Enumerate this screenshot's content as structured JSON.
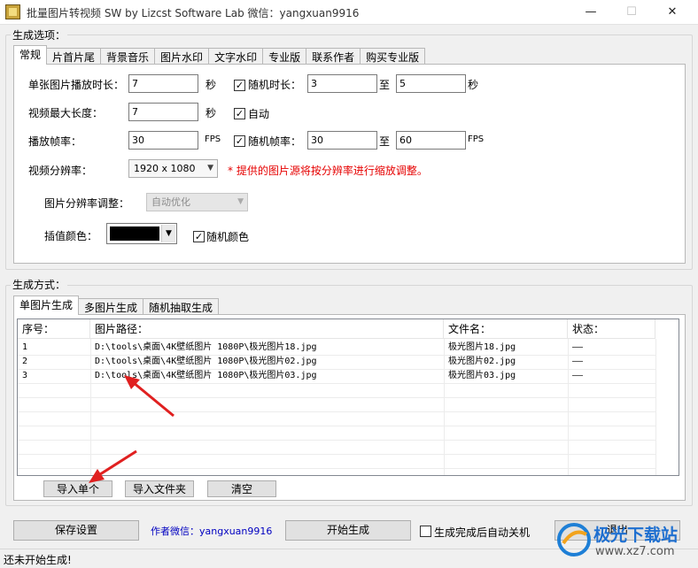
{
  "window": {
    "title": "批量图片转视频 SW  by Lizcst Software Lab  微信：yangxuan9916",
    "min_icon": "—",
    "max_icon": "☐",
    "close_icon": "✕"
  },
  "options_group": {
    "label": "生成选项：",
    "tabs": [
      "常规",
      "片首片尾",
      "背景音乐",
      "图片水印",
      "文字水印",
      "专业版",
      "联系作者",
      "购买专业版"
    ],
    "active_tab": "常规"
  },
  "general": {
    "single_duration_label": "单张图片播放时长：",
    "single_duration_value": "7",
    "single_duration_unit": "秒",
    "random_duration_label": "随机时长：",
    "random_duration_checked": true,
    "random_duration_from": "3",
    "random_duration_to_label": "至",
    "random_duration_to": "5",
    "random_duration_unit": "秒",
    "max_length_label": "视频最大长度：",
    "max_length_value": "7",
    "max_length_unit": "秒",
    "auto_label": "自动",
    "auto_checked": true,
    "fps_label": "播放帧率：",
    "fps_value": "30",
    "fps_unit": "FPS",
    "random_fps_label": "随机帧率：",
    "random_fps_checked": true,
    "random_fps_from": "30",
    "random_fps_to_label": "至",
    "random_fps_to": "60",
    "random_fps_unit": "FPS",
    "resolution_label": "视频分辨率：",
    "resolution_value": "1920 x 1080",
    "resolution_hint": "* 提供的图片源将按分辨率进行缩放调整。",
    "img_resize_label": "图片分辨率调整：",
    "img_resize_value": "自动优化",
    "fill_color_label": "插值颜色：",
    "fill_color_hex": "#000000",
    "random_color_label": "随机颜色",
    "random_color_checked": true
  },
  "mode_group": {
    "label": "生成方式：",
    "tabs": [
      "单图片生成",
      "多图片生成",
      "随机抽取生成"
    ],
    "active_tab": "单图片生成"
  },
  "table": {
    "columns": [
      "序号：",
      "图片路径：",
      "文件名：",
      "状态："
    ],
    "rows": [
      {
        "index": "1",
        "path": "D:\\tools\\桌面\\4K壁纸图片 1080P\\极光图片18.jpg",
        "name": "极光图片18.jpg",
        "status": "——"
      },
      {
        "index": "2",
        "path": "D:\\tools\\桌面\\4K壁纸图片 1080P\\极光图片02.jpg",
        "name": "极光图片02.jpg",
        "status": "——"
      },
      {
        "index": "3",
        "path": "D:\\tools\\桌面\\4K壁纸图片 1080P\\极光图片03.jpg",
        "name": "极光图片03.jpg",
        "status": "——"
      }
    ]
  },
  "list_buttons": {
    "import_single": "导入单个",
    "import_folder": "导入文件夹",
    "clear": "清空"
  },
  "bottom": {
    "save_settings": "保存设置",
    "author_wechat": "作者微信：yangxuan9916",
    "start": "开始生成",
    "auto_shutdown_label": "生成完成后自动关机",
    "auto_shutdown_checked": false,
    "exit": "退出"
  },
  "status": {
    "text": "还未开始生成!"
  },
  "watermark": {
    "site_name": "极光下载站",
    "site_url": "www.xz7.com"
  },
  "colors": {
    "accent_red": "#e60000",
    "link_blue": "#0000c0",
    "annotation_arrow": "#e02020"
  }
}
